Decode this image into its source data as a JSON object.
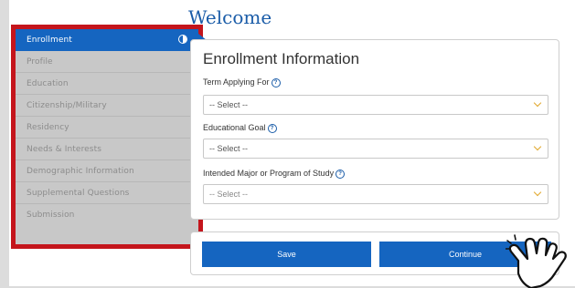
{
  "page": {
    "title": "Welcome"
  },
  "sidebar": {
    "items": [
      {
        "label": "Enrollment",
        "active": true
      },
      {
        "label": "Profile"
      },
      {
        "label": "Education"
      },
      {
        "label": "Citizenship/Military"
      },
      {
        "label": "Residency"
      },
      {
        "label": "Needs & Interests"
      },
      {
        "label": "Demographic Information"
      },
      {
        "label": "Supplemental Questions"
      },
      {
        "label": "Submission"
      }
    ]
  },
  "form": {
    "title": "Enrollment Information",
    "fields": [
      {
        "label": "Term Applying For",
        "value": "-- Select --"
      },
      {
        "label": "Educational Goal",
        "value": "-- Select --"
      },
      {
        "label": "Intended Major or Program of Study",
        "value": "-- Select --"
      }
    ]
  },
  "actions": {
    "save": "Save",
    "continue": "Continue"
  },
  "colors": {
    "accent": "#1565c0",
    "highlight": "#c4151c",
    "chevron": "#e0a82e"
  }
}
